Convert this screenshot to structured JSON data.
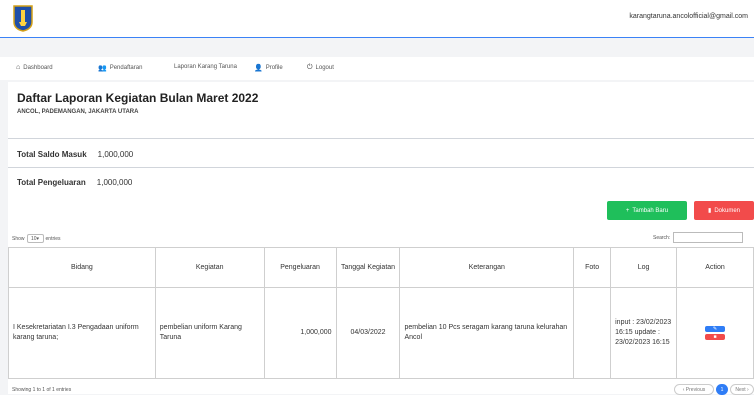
{
  "header": {
    "email": "karangtaruna.ancolofficial@gmail.com"
  },
  "nav": [
    {
      "icon": "home-icon",
      "label": "Dashboard"
    },
    {
      "icon": "users-icon",
      "label": "Pendaftaran"
    },
    {
      "icon": "",
      "label": "Laporan Karang Taruna"
    },
    {
      "icon": "user-icon",
      "label": "Profile"
    },
    {
      "icon": "power-icon",
      "label": "Logout"
    }
  ],
  "page": {
    "title": "Daftar Laporan Kegiatan Bulan Maret 2022",
    "subtitle": "ANCOL, PADEMANGAN, JAKARTA UTARA"
  },
  "summary": {
    "saldo_label": "Total Saldo Masuk",
    "saldo_value": "1,000,000",
    "pengeluaran_label": "Total Pengeluaran",
    "pengeluaran_value": "1,000,000"
  },
  "buttons": {
    "add": "Tambah Baru",
    "doc": "Dokumen"
  },
  "table_controls": {
    "show_prefix": "Show",
    "entries_value": "10",
    "entries_suffix": "entries",
    "search_label": "Search:"
  },
  "table": {
    "headers": [
      "Bidang",
      "Kegiatan",
      "Pengeluaran",
      "Tanggal Kegiatan",
      "Keterangan",
      "Foto",
      "Log",
      "Action"
    ],
    "rows": [
      {
        "bidang": "I Kesekretariatan I.3 Pengadaan uniform karang taruna;",
        "kegiatan": "pembelian uniform Karang Taruna",
        "pengeluaran": "1,000,000",
        "tanggal": "04/03/2022",
        "keterangan": "pembelian 10 Pcs seragam karang taruna kelurahan Ancol",
        "foto": "",
        "log": "input : 23/02/2023 16:15 update : 23/02/2023 16:15"
      }
    ]
  },
  "pagination": {
    "info": "Showing 1 to 1 of 1 entries",
    "previous": "‹ Previous",
    "current": "1",
    "next": "Next ›"
  },
  "colors": {
    "green": "#1fbf5b",
    "red": "#f24b4b",
    "blue": "#2f7df6"
  }
}
